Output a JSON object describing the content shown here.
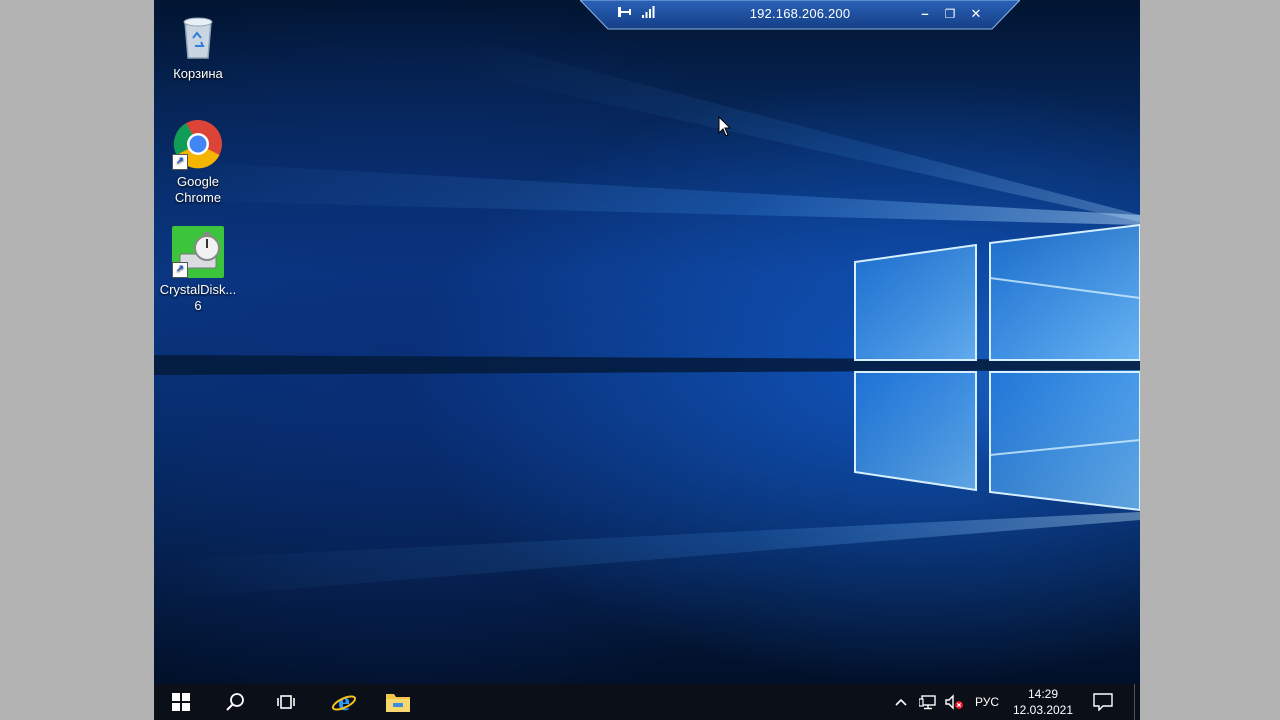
{
  "rdp": {
    "title": "192.168.206.200",
    "pin_icon": "pin-icon",
    "signal_icon": "signal-bars-icon",
    "minimize": "–",
    "restore": "❐",
    "close": "✕"
  },
  "desktop": {
    "icons": [
      {
        "label": "Корзина",
        "icon": "recycle-bin-icon"
      },
      {
        "label": "Google Chrome",
        "icon": "chrome-icon"
      },
      {
        "label": "CrystalDisk... 6",
        "icon": "crystaldiskmark-icon"
      }
    ]
  },
  "taskbar": {
    "items": [
      "start-icon",
      "search-icon",
      "task-view-icon",
      "internet-explorer-icon",
      "file-explorer-icon"
    ],
    "tray": {
      "language": "РУС",
      "time": "14:29",
      "date": "12.03.2021"
    }
  },
  "colors": {
    "taskbar": "#0b0f17",
    "accent": "#1a6fdc",
    "rdp_bar": "#1d4fa0"
  }
}
